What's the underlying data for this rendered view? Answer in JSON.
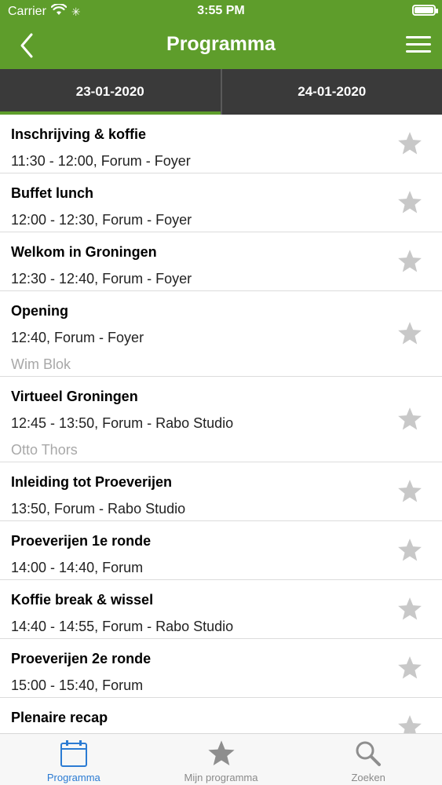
{
  "status": {
    "carrier": "Carrier",
    "time": "3:55 PM"
  },
  "nav": {
    "title": "Programma"
  },
  "tabs": [
    {
      "label": "23-01-2020",
      "active": true
    },
    {
      "label": "24-01-2020",
      "active": false
    }
  ],
  "items": [
    {
      "title": "Inschrijving & koffie",
      "meta": "11:30 - 12:00, Forum - Foyer",
      "speaker": ""
    },
    {
      "title": "Buffet lunch",
      "meta": "12:00 - 12:30, Forum - Foyer",
      "speaker": ""
    },
    {
      "title": "Welkom in Groningen",
      "meta": "12:30 - 12:40, Forum - Foyer",
      "speaker": ""
    },
    {
      "title": "Opening",
      "meta": "12:40, Forum - Foyer",
      "speaker": "Wim Blok"
    },
    {
      "title": "Virtueel Groningen",
      "meta": "12:45 - 13:50, Forum - Rabo Studio",
      "speaker": "Otto Thors"
    },
    {
      "title": "Inleiding tot Proeverijen",
      "meta": "13:50, Forum - Rabo Studio",
      "speaker": ""
    },
    {
      "title": "Proeverijen 1e ronde",
      "meta": "14:00 - 14:40, Forum",
      "speaker": ""
    },
    {
      "title": "Koffie break & wissel",
      "meta": "14:40 - 14:55, Forum - Rabo Studio",
      "speaker": ""
    },
    {
      "title": "Proeverijen 2e ronde",
      "meta": "15:00 - 15:40, Forum",
      "speaker": ""
    },
    {
      "title": "Plenaire recap",
      "meta": "",
      "speaker": ""
    }
  ],
  "tabbar": [
    {
      "label": "Programma",
      "icon": "calendar-icon",
      "active": true
    },
    {
      "label": "Mijn programma",
      "icon": "star-icon",
      "active": false
    },
    {
      "label": "Zoeken",
      "icon": "search-icon",
      "active": false
    }
  ],
  "colors": {
    "brand": "#5e9d2b",
    "tabs_bg": "#3a3a3a",
    "star": "#c8c8c8",
    "active_tab": "#2b7bd3"
  }
}
